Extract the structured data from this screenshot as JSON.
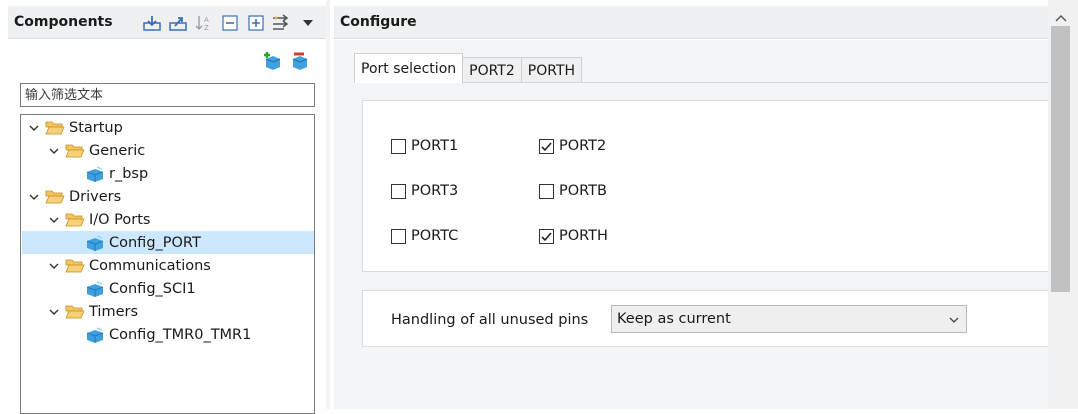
{
  "components_panel": {
    "title": "Components",
    "toolbar_icons": [
      "import-icon",
      "export-icon",
      "sort-az-icon",
      "collapse-all-icon",
      "expand-all-icon",
      "filter-options-icon",
      "menu-dropdown-icon"
    ],
    "add_icons": [
      "add-component-icon",
      "remove-component-icon"
    ],
    "filter": {
      "placeholder": "输入筛选文本",
      "value": ""
    },
    "tree": [
      {
        "label": "Startup",
        "type": "folder",
        "level": 0,
        "expanded": true
      },
      {
        "label": "Generic",
        "type": "folder",
        "level": 1,
        "expanded": true
      },
      {
        "label": "r_bsp",
        "type": "component",
        "level": 2
      },
      {
        "label": "Drivers",
        "type": "folder",
        "level": 0,
        "expanded": true
      },
      {
        "label": "I/O Ports",
        "type": "folder",
        "level": 1,
        "expanded": true
      },
      {
        "label": "Config_PORT",
        "type": "component",
        "level": 2,
        "selected": true
      },
      {
        "label": "Communications",
        "type": "folder",
        "level": 1,
        "expanded": true
      },
      {
        "label": "Config_SCI1",
        "type": "component",
        "level": 2
      },
      {
        "label": "Timers",
        "type": "folder",
        "level": 1,
        "expanded": true
      },
      {
        "label": "Config_TMR0_TMR1",
        "type": "component",
        "level": 2
      }
    ]
  },
  "configure_panel": {
    "title": "Configure",
    "tabs": [
      {
        "label": "Port selection",
        "active": true
      },
      {
        "label": "PORT2",
        "active": false
      },
      {
        "label": "PORTH",
        "active": false
      }
    ],
    "ports": [
      {
        "label": "PORT1",
        "checked": false
      },
      {
        "label": "PORT2",
        "checked": true
      },
      {
        "label": "PORT3",
        "checked": false
      },
      {
        "label": "PORTB",
        "checked": false
      },
      {
        "label": "PORTC",
        "checked": false
      },
      {
        "label": "PORTH",
        "checked": true
      }
    ],
    "unused_pins": {
      "label": "Handling of all unused pins",
      "selected": "Keep as current"
    }
  },
  "colors": {
    "header_bg": "#eef0f2",
    "selection_bg": "#cce8ff",
    "folder": "#e8b04a",
    "component": "#2a8fd8"
  }
}
